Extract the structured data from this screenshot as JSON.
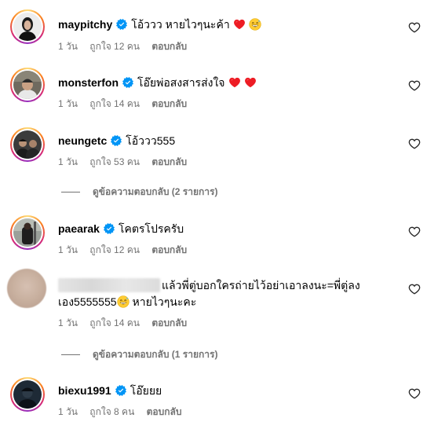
{
  "comments": [
    {
      "username": "maypitchy",
      "text": "โอ้ววว หายไวๆนะค้า",
      "time": "1 วัน",
      "likes": "ถูกใจ 12 คน",
      "reply": "ตอบกลับ",
      "emojis": [
        "red-heart",
        "grinning-sweat"
      ]
    },
    {
      "username": "monsterfon",
      "text": "โอ๊ยพ่อสงสารส่งใจ",
      "time": "1 วัน",
      "likes": "ถูกใจ 14 คน",
      "reply": "ตอบกลับ",
      "emojis": [
        "red-heart",
        "red-heart"
      ]
    },
    {
      "username": "neungetc",
      "text": "โอ้ววว555",
      "time": "1 วัน",
      "likes": "ถูกใจ 53 คน",
      "reply": "ตอบกลับ",
      "view_replies": "ดูข้อความตอบกลับ (2 รายการ)"
    },
    {
      "username": "paearak",
      "text": "โคตรโปรครับ",
      "time": "1 วัน",
      "likes": "ถูกใจ 12 คน",
      "reply": "ตอบกลับ"
    },
    {
      "username": "",
      "text_line1": "แล้วพี่ตู่บอกใครถ่ายไว้อย่าเอาลงนะ=พี่ตู่ลง",
      "text_line2a": "เอง5555555",
      "text_line2b": "หายไวๆนะคะ",
      "time": "1 วัน",
      "likes": "ถูกใจ 14 คน",
      "reply": "ตอบกลับ",
      "view_replies": "ดูข้อความตอบกลับ (1 รายการ)",
      "emojis": [
        "grinning-sweat"
      ]
    },
    {
      "username": "biexu1991",
      "text": "โอ๊ยยย",
      "time": "1 วัน",
      "likes": "ถูกใจ 8 คน",
      "reply": "ตอบกลับ"
    }
  ],
  "colors": {
    "meta_gray": "#737373",
    "verified_blue": "#0095f6",
    "heart_red": "#ed1c24"
  }
}
